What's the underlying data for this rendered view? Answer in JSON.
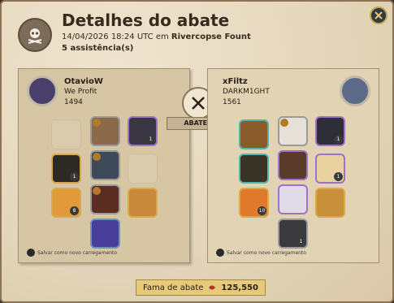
{
  "header": {
    "title": "Detalhes do abate",
    "timestamp": "14/04/2026 18:24 UTC em",
    "location": "Rivercopse Fount",
    "assists": "5 assistência(s)"
  },
  "killer": {
    "name": "OtavioW",
    "guild": "We Profit",
    "power": "1494",
    "equipment": [
      {
        "slot": "bag",
        "quality": "empty",
        "qty": ""
      },
      {
        "slot": "head",
        "quality": "grey",
        "qty": ""
      },
      {
        "slot": "cape",
        "quality": "purple",
        "qty": "1"
      },
      {
        "slot": "weapon",
        "quality": "gold",
        "qty": "1"
      },
      {
        "slot": "armor",
        "quality": "grey",
        "qty": ""
      },
      {
        "slot": "offhand",
        "quality": "empty",
        "qty": ""
      },
      {
        "slot": "potion",
        "quality": "gold",
        "qty": "8"
      },
      {
        "slot": "shoes",
        "quality": "grey",
        "qty": ""
      },
      {
        "slot": "food",
        "quality": "gold",
        "qty": ""
      },
      {
        "slot": "mount",
        "quality": "blue",
        "qty": ""
      }
    ],
    "save_label": "Salvar como novo carregamento"
  },
  "victim": {
    "name": "xFiltz",
    "guild": "DARKM1GHT",
    "power": "1561",
    "equipment": [
      {
        "slot": "bag",
        "quality": "teal",
        "qty": ""
      },
      {
        "slot": "head",
        "quality": "grey",
        "qty": ""
      },
      {
        "slot": "cape",
        "quality": "purple",
        "qty": "1"
      },
      {
        "slot": "weapon",
        "quality": "teal",
        "qty": ""
      },
      {
        "slot": "armor",
        "quality": "purple",
        "qty": ""
      },
      {
        "slot": "offhand",
        "quality": "purple",
        "qty": "1"
      },
      {
        "slot": "potion",
        "quality": "gold",
        "qty": "10"
      },
      {
        "slot": "shoes",
        "quality": "purple",
        "qty": ""
      },
      {
        "slot": "food",
        "quality": "gold",
        "qty": ""
      },
      {
        "slot": "mount",
        "quality": "grey",
        "qty": "1"
      }
    ],
    "save_label": "Salvar como novo carregamento"
  },
  "kill_label": "ABATEU",
  "fame": {
    "label": "Fama de abate",
    "value": "125,550"
  },
  "colors": {
    "background": "#e8dcc4",
    "accent": "#c9a548",
    "quality_purple": "#9e72c8",
    "quality_gold": "#d9a94a",
    "quality_teal": "#54b3ad"
  }
}
